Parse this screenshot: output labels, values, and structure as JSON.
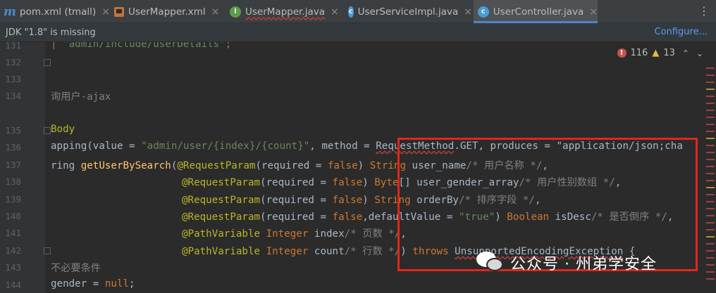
{
  "tabs": [
    {
      "label": "pom.xml (tmall)",
      "icon": "maven-icon",
      "active": false
    },
    {
      "label": "UserMapper.xml",
      "icon": "xml-file-icon",
      "active": false
    },
    {
      "label": "UserMapper.java",
      "icon": "interface-icon",
      "active": false
    },
    {
      "label": "UserServiceImpl.java",
      "icon": "class-icon",
      "active": false
    },
    {
      "label": "UserController.java",
      "icon": "class-icon",
      "active": true
    }
  ],
  "notification": {
    "message": "JDK \"1.8\" is missing",
    "action": "Configure..."
  },
  "inspections": {
    "errors": "116",
    "warnings": "13"
  },
  "lines": [
    {
      "no": "131",
      "text": "\"admin/include/userDetails\";"
    },
    {
      "no": "132",
      "text": "}"
    },
    {
      "no": "133",
      "text": ""
    },
    {
      "no": "134",
      "text": "询用户-ajax"
    },
    {
      "no": "135",
      "text": "Body"
    },
    {
      "no": "136",
      "text": "apping(value = \"admin/user/{index}/{count}\", method = RequestMethod.GET, produces = \"application/json;cha"
    },
    {
      "no": "137",
      "text": "ring getUserBySearch(@RequestParam(required = false) String user_name/* 用户名称 */,"
    },
    {
      "no": "138",
      "text": "@RequestParam(required = false) Byte[] user_gender_array/* 用户性别数组 */,"
    },
    {
      "no": "139",
      "text": "@RequestParam(required = false) String orderBy/* 排序字段 */,"
    },
    {
      "no": "140",
      "text": "@RequestParam(required = false,defaultValue = \"true\") Boolean isDesc/* 是否倒序 */,"
    },
    {
      "no": "141",
      "text": "@PathVariable Integer index/* 页数 */,"
    },
    {
      "no": "142",
      "text": "@PathVariable Integer count/* 行数 */) throws UnsupportedEncodingException {"
    },
    {
      "no": "143",
      "text": "不必要条件"
    },
    {
      "no": "144",
      "text": "gender = null;"
    }
  ],
  "watermark": "公众号 · 州弟学安全",
  "colors": {
    "highlight_box": "#e0261e",
    "active_tab_underline": "#4a88c7",
    "link": "#589df6"
  }
}
